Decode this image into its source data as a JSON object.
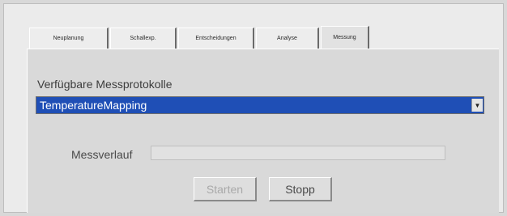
{
  "tabs": [
    {
      "label": "Neuplanung"
    },
    {
      "label": "Schallexp."
    },
    {
      "label": "Entscheidungen"
    },
    {
      "label": "Analyse"
    },
    {
      "label": "Messung",
      "active": true
    }
  ],
  "messung": {
    "protocols_label": "Verfügbare Messprotokolle",
    "selected_protocol": "TemperatureMapping",
    "progress_label": "Messverlauf",
    "progress_value": 0,
    "start_label": "Starten",
    "stop_label": "Stopp"
  },
  "colors": {
    "selection": "#1f4fb6",
    "panel": "#d9d9d9"
  }
}
